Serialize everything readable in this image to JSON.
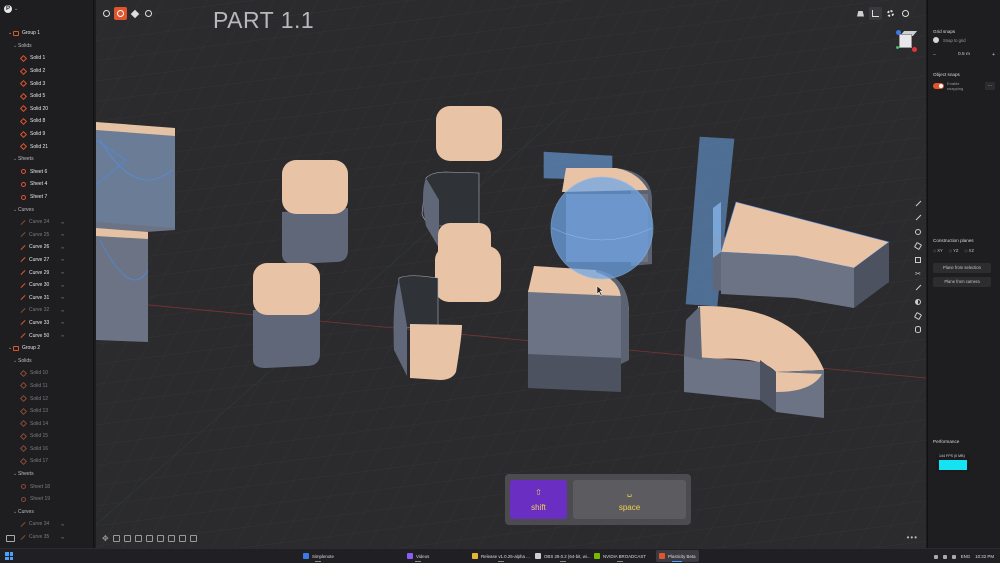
{
  "viewport": {
    "title": "PART 1.1",
    "more_label": "•••"
  },
  "outliner": {
    "groups": [
      {
        "name": "Group 1",
        "sections": [
          {
            "name": "Solids",
            "kind": "solid",
            "dim": false,
            "items": [
              "Solid 1",
              "Solid 2",
              "Solid 3",
              "Solid 5",
              "Solid 20",
              "Solid 8",
              "Solid 9",
              "Solid 21"
            ]
          },
          {
            "name": "Sheets",
            "kind": "sheet",
            "dim": false,
            "items": [
              "Sheet 6",
              "Sheet 4",
              "Sheet 7"
            ]
          },
          {
            "name": "Curves",
            "kind": "curve",
            "dim": false,
            "items": [
              "Curve 24",
              "Curve 25",
              "Curve 26",
              "Curve 27",
              "Curve 29",
              "Curve 30",
              "Curve 31",
              "Curve 32",
              "Curve 33",
              "Curve 50"
            ]
          }
        ]
      },
      {
        "name": "Group 2",
        "sections": [
          {
            "name": "Solids",
            "kind": "solid",
            "dim": true,
            "items": [
              "Solid 10",
              "Solid 11",
              "Solid 12",
              "Solid 13",
              "Solid 14",
              "Solid 15",
              "Solid 16",
              "Solid 17"
            ]
          },
          {
            "name": "Sheets",
            "kind": "sheet",
            "dim": true,
            "items": [
              "Sheet 18",
              "Sheet 19"
            ]
          },
          {
            "name": "Curves",
            "kind": "curve",
            "dim": true,
            "items": [
              "Curve 34",
              "Curve 35"
            ]
          }
        ]
      }
    ],
    "dim_items_group1": [
      "Curve 24",
      "Curve 25",
      "Curve 32"
    ]
  },
  "keys": {
    "shift_label": "shift",
    "shift_symbol": "⇧",
    "space_label": "space",
    "space_symbol": "␣"
  },
  "props": {
    "grid_snaps_heading": "Grid snaps",
    "snap_to_grid_label": "Snap to grid",
    "step_minus": "−",
    "step_value": "0.5 m",
    "step_plus": "+",
    "object_snaps_heading": "Object snaps",
    "enable_snapping_label": "Enable snapping",
    "object_snaps_menu": "...",
    "construction_planes_heading": "Construction planes",
    "planes": [
      "XY",
      "YZ",
      "XZ"
    ],
    "plane_from_selection": "Plane from selection",
    "plane_from_camera": "Plane from camera",
    "performance_heading": "Performance",
    "fps_text": "144 FPS (0 MB)"
  },
  "taskbar": {
    "items": [
      {
        "label": "Simplenote",
        "color": "#3a7be8",
        "active": false
      },
      {
        "label": "Videos",
        "color": "#8b5cf6",
        "active": false
      },
      {
        "label": "Release v1.0.25-alpha ...",
        "color": "#e8b33a",
        "active": false
      },
      {
        "label": "OBS 29.0.2 (64-bit, wi...",
        "color": "#cfcfd2",
        "active": false
      },
      {
        "label": "NVIDIA BROADCAST",
        "color": "#76b900",
        "active": false
      },
      {
        "label": "Plasticity Beta",
        "color": "#e0552e",
        "active": true
      }
    ],
    "language": "ENG",
    "time": "10:32 PM"
  },
  "colors": {
    "accent": "#e0552e",
    "face_top": "#e8c3a6",
    "face_side": "#6a7280",
    "selection_blue": "#6ea6e8",
    "record_key": "#6a2fc2",
    "fps_bar": "#16e3f2"
  }
}
